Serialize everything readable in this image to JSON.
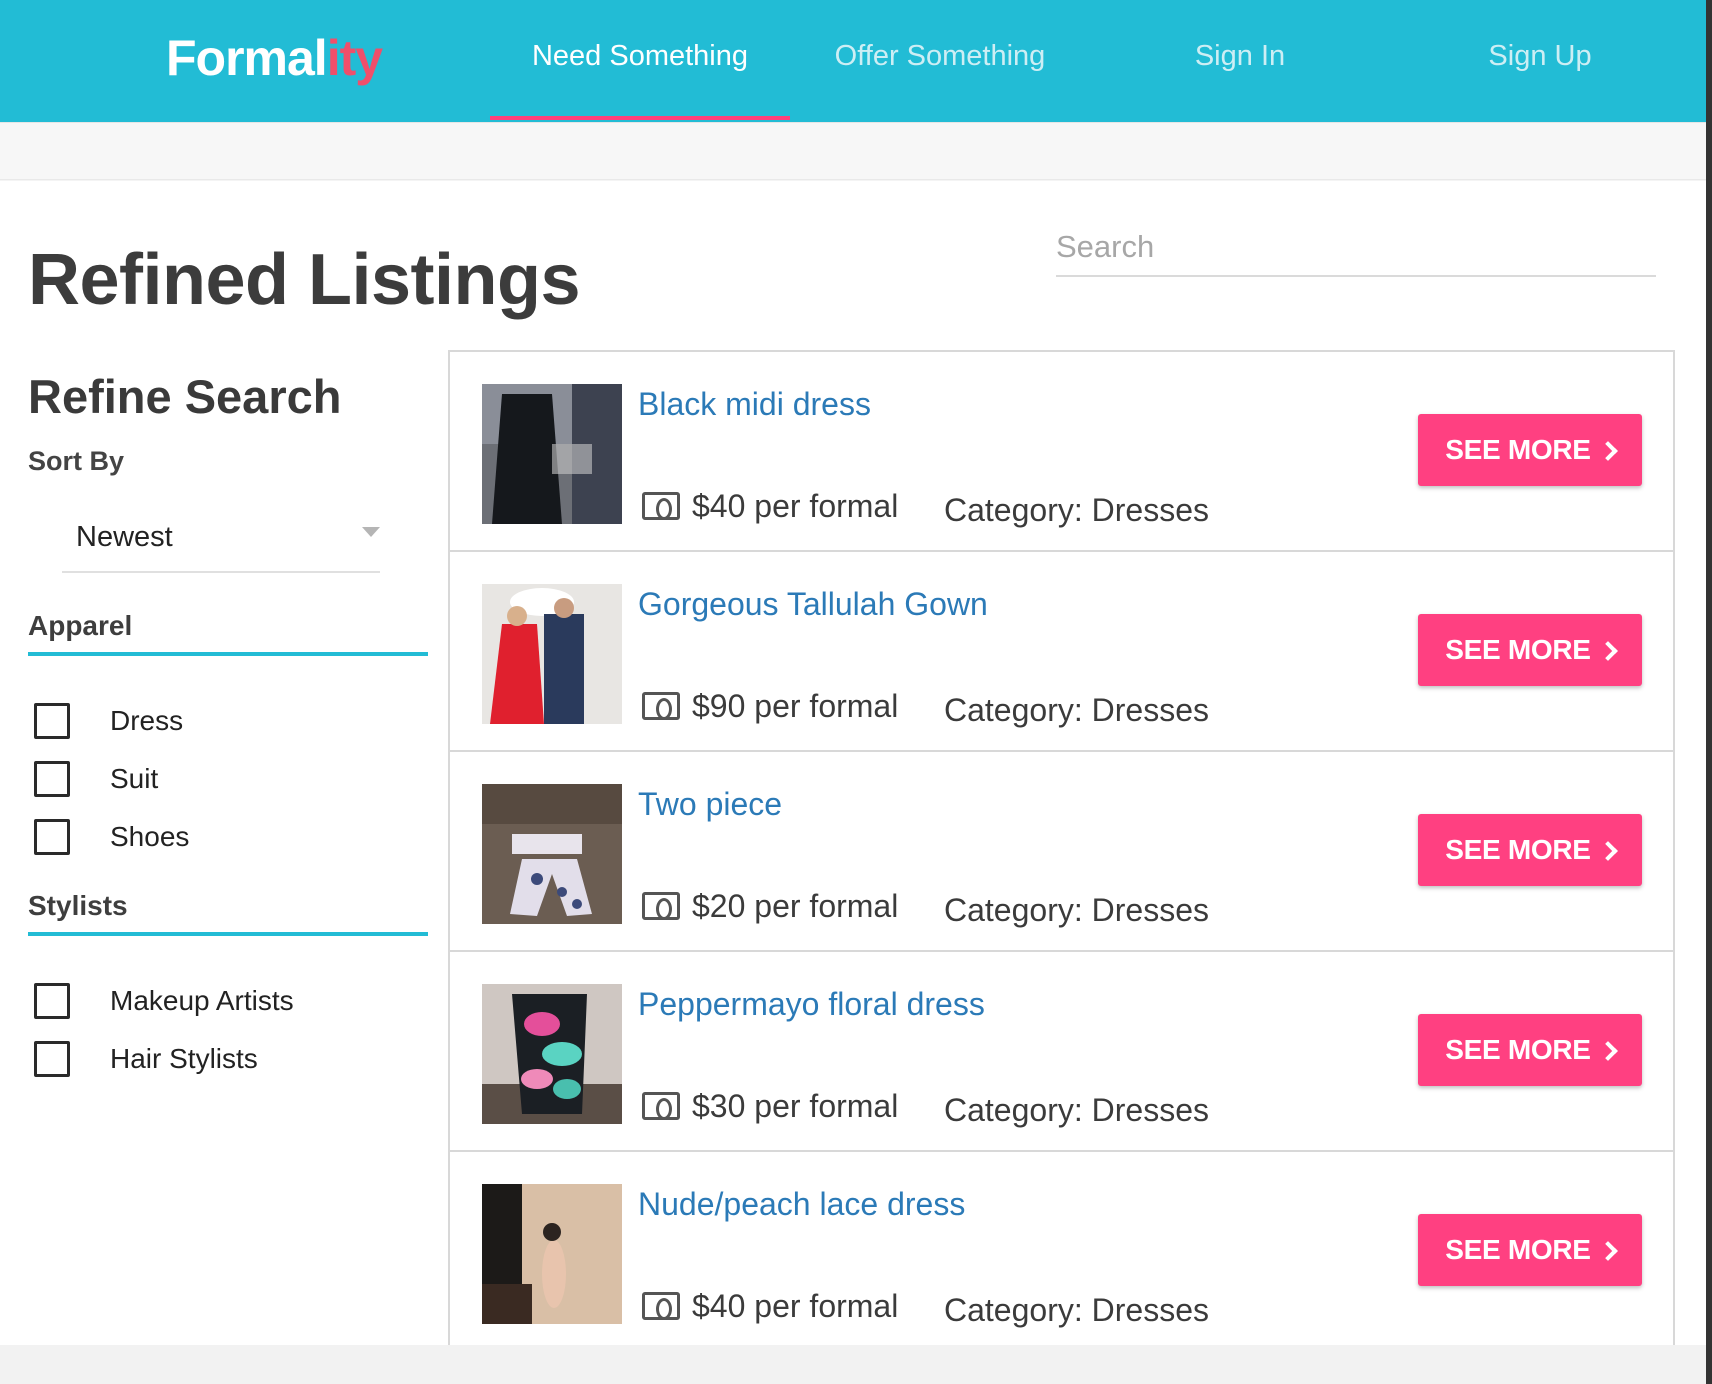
{
  "nav": {
    "brand_main": "Formal",
    "brand_accent": "ity",
    "links": [
      {
        "label": "Need Something"
      },
      {
        "label": "Offer Something"
      },
      {
        "label": "Sign In"
      },
      {
        "label": "Sign Up"
      }
    ],
    "active_index": 0,
    "colors": {
      "bar": "#22bcd5",
      "underline": "#ff3f7a"
    }
  },
  "page": {
    "title": "Refined Listings",
    "search_placeholder": "Search"
  },
  "sidebar": {
    "title": "Refine Search",
    "sort_label": "Sort By",
    "sort_value": "Newest",
    "apparel": {
      "heading": "Apparel",
      "options": [
        {
          "label": "Dress",
          "checked": false
        },
        {
          "label": "Suit",
          "checked": false
        },
        {
          "label": "Shoes",
          "checked": false
        }
      ]
    },
    "stylists": {
      "heading": "Stylists",
      "options": [
        {
          "label": "Makeup Artists",
          "checked": false
        },
        {
          "label": "Hair Stylists",
          "checked": false
        }
      ]
    }
  },
  "listings": [
    {
      "title": "Black midi dress",
      "price": "$40 per formal",
      "category": "Category: Dresses",
      "button": "SEE MORE"
    },
    {
      "title": "Gorgeous Tallulah Gown",
      "price": "$90 per formal",
      "category": "Category: Dresses",
      "button": "SEE MORE"
    },
    {
      "title": "Two piece",
      "price": "$20 per formal",
      "category": "Category: Dresses",
      "button": "SEE MORE"
    },
    {
      "title": "Peppermayo floral dress",
      "price": "$30 per formal",
      "category": "Category: Dresses",
      "button": "SEE MORE"
    },
    {
      "title": "Nude/peach lace dress",
      "price": "$40 per formal",
      "category": "Category: Dresses",
      "button": "SEE MORE"
    }
  ],
  "colors": {
    "accent": "#ff4081",
    "link": "#2b7ab7"
  }
}
